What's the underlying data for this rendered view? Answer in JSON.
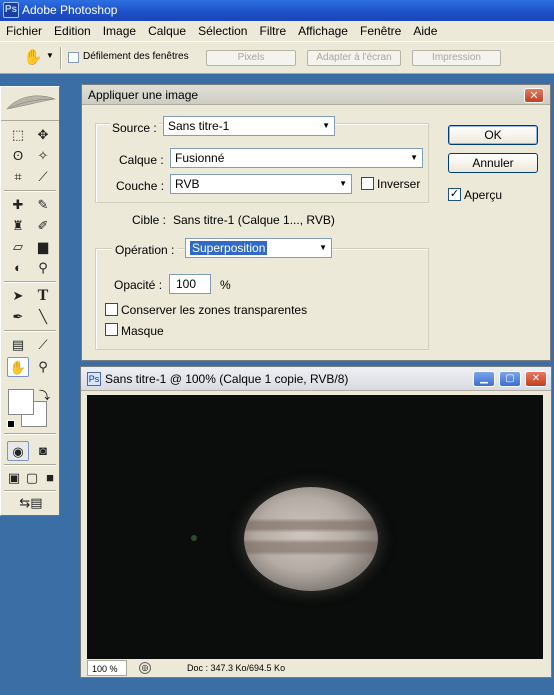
{
  "app": {
    "title": "Adobe Photoshop"
  },
  "menu": [
    "Fichier",
    "Edition",
    "Image",
    "Calque",
    "Sélection",
    "Filtre",
    "Affichage",
    "Fenêtre",
    "Aide"
  ],
  "options_bar": {
    "checkbox_label": "Défilement des fenêtres",
    "buttons": [
      "Pixels",
      "Adapter à l'écran",
      "Impression"
    ]
  },
  "dialog": {
    "title": "Appliquer une image",
    "source_label": "Source :",
    "source_value": "Sans titre-1",
    "layer_label": "Calque :",
    "layer_value": "Fusionné",
    "channel_label": "Couche :",
    "channel_value": "RVB",
    "invert_label": "Inverser",
    "target_label": "Cible :",
    "target_value": "Sans titre-1 (Calque 1..., RVB)",
    "operation_label": "Opération :",
    "operation_value": "Superposition",
    "opacity_label": "Opacité :",
    "opacity_value": "100",
    "opacity_unit": "%",
    "preserve_label": "Conserver les zones transparentes",
    "mask_label": "Masque",
    "ok_label": "OK",
    "cancel_label": "Annuler",
    "preview_label": "Aperçu",
    "preview_checked": true,
    "invert_checked": false,
    "preserve_checked": false,
    "mask_checked": false
  },
  "document": {
    "title": "Sans titre-1 @ 100% (Calque 1 copie, RVB/8)",
    "zoom": "100 %",
    "doc_info": "Doc : 347.3 Ko/694.5 Ko"
  }
}
